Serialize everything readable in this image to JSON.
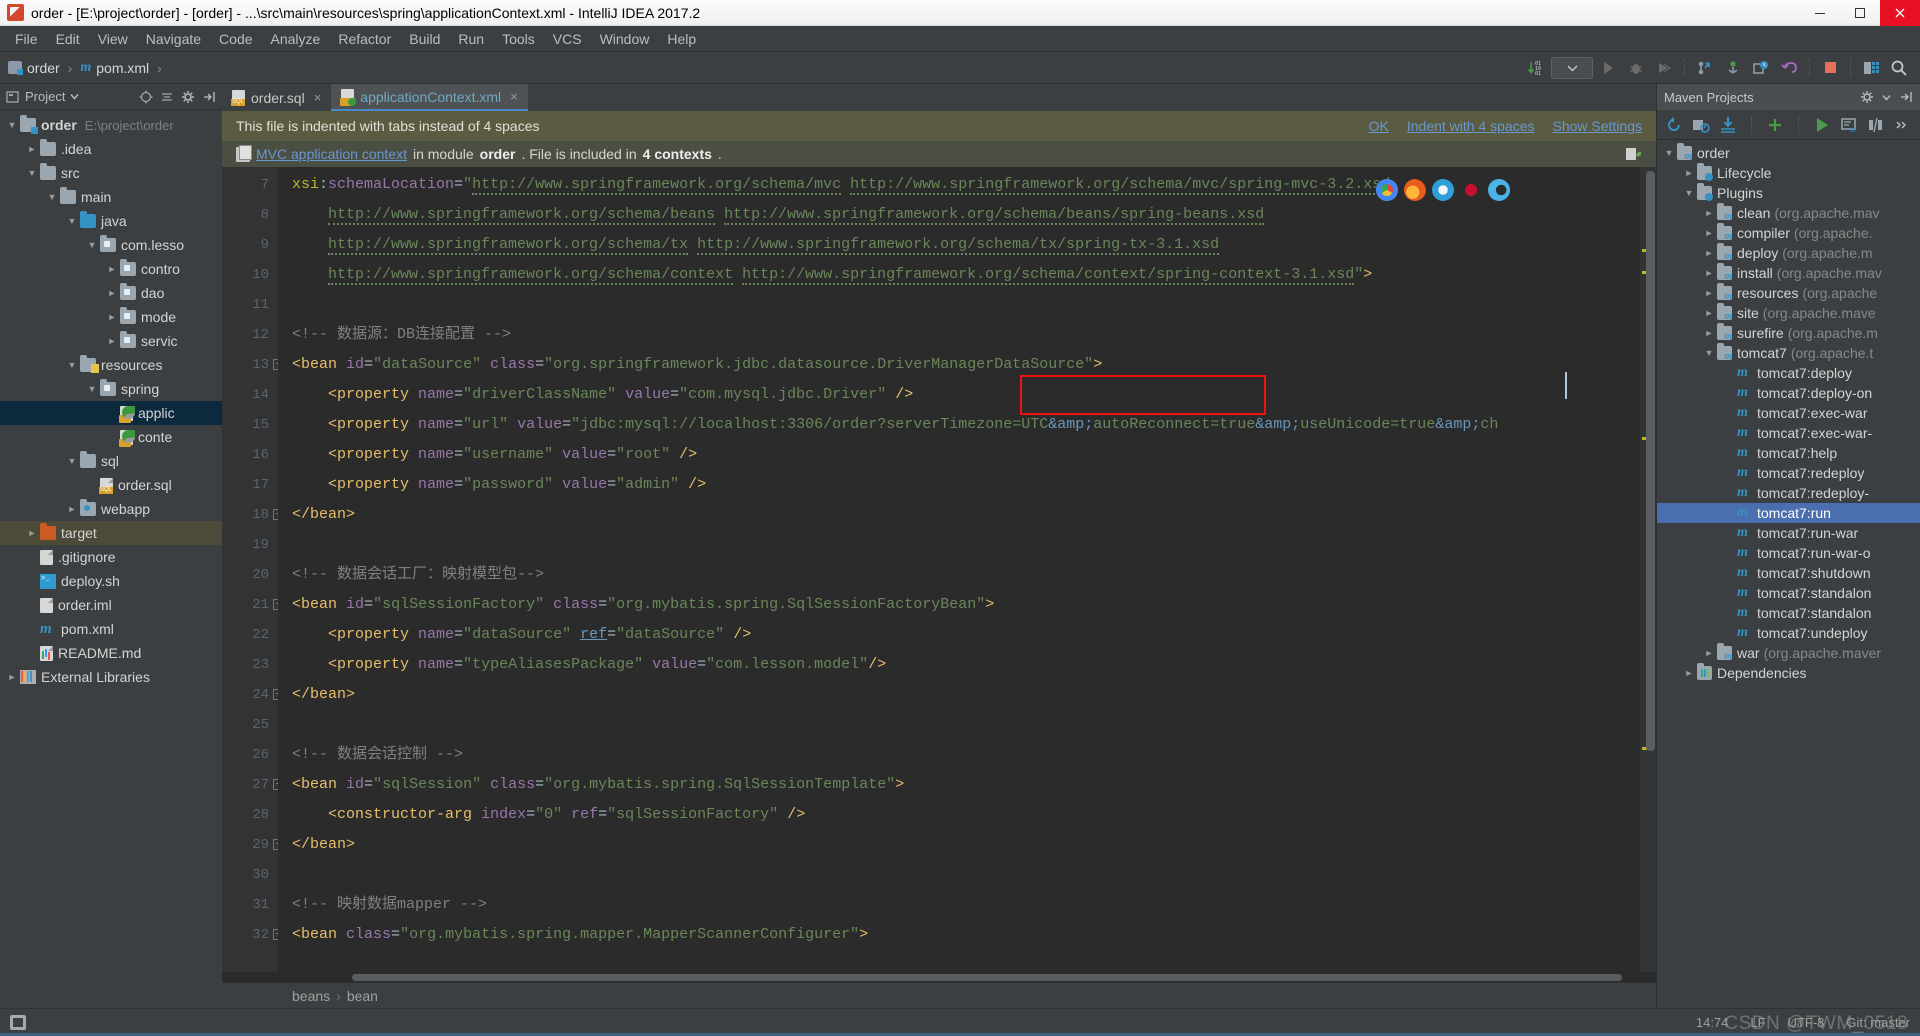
{
  "window": {
    "title": "order - [E:\\project\\order] - [order] - ...\\src\\main\\resources\\spring\\applicationContext.xml - IntelliJ IDEA 2017.2",
    "app_icon": "intellij-idea-icon",
    "minimize": "minimize-icon",
    "maximize": "maximize-icon",
    "close": "close-icon"
  },
  "menu": {
    "items": [
      {
        "label": "File"
      },
      {
        "label": "Edit"
      },
      {
        "label": "View"
      },
      {
        "label": "Navigate"
      },
      {
        "label": "Code"
      },
      {
        "label": "Analyze"
      },
      {
        "label": "Refactor"
      },
      {
        "label": "Build"
      },
      {
        "label": "Run"
      },
      {
        "label": "Tools"
      },
      {
        "label": "VCS"
      },
      {
        "label": "Window"
      },
      {
        "label": "Help"
      }
    ]
  },
  "toolbar": {
    "breadcrumb": [
      {
        "label": "order",
        "icon": "module-icon"
      },
      {
        "label": "pom.xml",
        "icon": "maven-m-icon"
      }
    ],
    "run_config": "",
    "icons": [
      "line-numbers-icon",
      "run-config-dropdown",
      "run-icon",
      "debug-icon",
      "coverage-icon",
      "update-project-icon",
      "commit-icon",
      "history-icon",
      "rollback-icon",
      "stop-icon",
      "database-icon",
      "search-everywhere-icon"
    ]
  },
  "project_panel": {
    "title": "Project",
    "header_icons": [
      "project-view-icon",
      "chevron-down-icon",
      "locate-icon",
      "collapse-all-icon",
      "gear-icon",
      "hide-icon"
    ],
    "tree": [
      {
        "label": "order",
        "path": "E:\\project\\order",
        "depth": 0,
        "arrow": "down",
        "icon": "module-folder",
        "bold": true
      },
      {
        "label": ".idea",
        "depth": 1,
        "arrow": "right",
        "icon": "folder"
      },
      {
        "label": "src",
        "depth": 1,
        "arrow": "down",
        "icon": "folder"
      },
      {
        "label": "main",
        "depth": 2,
        "arrow": "down",
        "icon": "folder"
      },
      {
        "label": "java",
        "depth": 3,
        "arrow": "down",
        "icon": "source-folder"
      },
      {
        "label": "com.lesso",
        "depth": 4,
        "arrow": "down",
        "icon": "package-folder"
      },
      {
        "label": "contro",
        "depth": 5,
        "arrow": "right",
        "icon": "package-folder"
      },
      {
        "label": "dao",
        "depth": 5,
        "arrow": "right",
        "icon": "package-folder"
      },
      {
        "label": "mode",
        "depth": 5,
        "arrow": "right",
        "icon": "package-folder"
      },
      {
        "label": "servic",
        "depth": 5,
        "arrow": "right",
        "icon": "package-folder"
      },
      {
        "label": "resources",
        "depth": 3,
        "arrow": "down",
        "icon": "resources-folder"
      },
      {
        "label": "spring",
        "depth": 4,
        "arrow": "down",
        "icon": "package-folder"
      },
      {
        "label": "applic",
        "depth": 5,
        "arrow": "none",
        "icon": "spring-xml-file",
        "selected": true
      },
      {
        "label": "conte",
        "depth": 5,
        "arrow": "none",
        "icon": "spring-xml-file"
      },
      {
        "label": "sql",
        "depth": 3,
        "arrow": "down",
        "icon": "folder"
      },
      {
        "label": "order.sql",
        "depth": 4,
        "arrow": "none",
        "icon": "sql-file"
      },
      {
        "label": "webapp",
        "depth": 3,
        "arrow": "right",
        "icon": "web-folder"
      },
      {
        "label": "target",
        "depth": 1,
        "arrow": "right",
        "icon": "excluded-folder",
        "highlighted": true
      },
      {
        "label": ".gitignore",
        "depth": 1,
        "arrow": "none",
        "icon": "gitignore-file"
      },
      {
        "label": "deploy.sh",
        "depth": 1,
        "arrow": "none",
        "icon": "shell-file"
      },
      {
        "label": "order.iml",
        "depth": 1,
        "arrow": "none",
        "icon": "iml-file"
      },
      {
        "label": "pom.xml",
        "depth": 1,
        "arrow": "none",
        "icon": "maven-m-icon"
      },
      {
        "label": "README.md",
        "depth": 1,
        "arrow": "none",
        "icon": "markdown-file"
      },
      {
        "label": "External Libraries",
        "depth": 0,
        "arrow": "right",
        "icon": "libraries-icon"
      }
    ]
  },
  "editor": {
    "tabs": [
      {
        "label": "order.sql",
        "icon": "sql-file-icon",
        "active": false
      },
      {
        "label": "applicationContext.xml",
        "icon": "spring-xml-file-icon",
        "active": true
      }
    ],
    "banner_indent": {
      "message": "This file is indented with tabs instead of 4 spaces",
      "links": [
        "OK",
        "Indent with 4 spaces",
        "Show Settings"
      ]
    },
    "banner_context": {
      "link": "MVC application context",
      "text_mid": "in module",
      "module": "order",
      "text_after": ". File is included in",
      "contexts": "4 contexts",
      "text_end": ".",
      "right_icon": "spring-config-icon"
    },
    "browsers": [
      "chrome-icon",
      "firefox-icon",
      "safari-icon",
      "opera-icon",
      "edge-icon"
    ],
    "first_line_number": 7,
    "lines": [
      {
        "n": 7,
        "fold": false,
        "html": "<span class=\"ns\">xsi</span><span class=\"plain\">:</span><span class=\"attr\">schemaLocation</span><span class=\"plain\">=</span><span class=\"str\">\"</span><span class=\"str wavy\">http://www.springframework.org/schema/mvc</span><span class=\"str\"> </span><span class=\"str wavy\">http://www.springframework.org/schema/mvc/spring-mvc-3.2.xsd</span>"
      },
      {
        "n": 8,
        "fold": false,
        "html": "    <span class=\"str wavy\">http://www.springframework.org/schema/beans</span><span class=\"str\"> </span><span class=\"str wavy\">http://www.springframework.org/schema/beans/spring-beans.xsd</span>"
      },
      {
        "n": 9,
        "fold": false,
        "html": "    <span class=\"str wavy\">http://www.springframework.org/schema/tx</span><span class=\"str\"> </span><span class=\"str wavy\">http://www.springframework.org/schema/tx/spring-tx-3.1.xsd</span>"
      },
      {
        "n": 10,
        "fold": false,
        "html": "    <span class=\"str wavy\">http://www.springframework.org/schema/context</span><span class=\"str\"> </span><span class=\"str wavy\">http://www.springframework.org/schema/context/spring-context-3.1.xsd</span><span class=\"str\">\"</span><span class=\"tag\">&gt;</span>"
      },
      {
        "n": 11,
        "fold": false,
        "html": ""
      },
      {
        "n": 12,
        "fold": false,
        "html": "<span class=\"cmt\">&lt;!-- 数据源：DB连接配置 --&gt;</span>"
      },
      {
        "n": 13,
        "fold": true,
        "html": "<span class=\"tag\">&lt;bean</span> <span class=\"attr\">id</span><span class=\"plain\">=</span><span class=\"str\">\"dataSource\"</span> <span class=\"attr\">class</span><span class=\"plain\">=</span><span class=\"str\">\"org.springframework.jdbc.datasource.DriverManagerDataSource\"</span><span class=\"tag\">&gt;</span>"
      },
      {
        "n": 14,
        "fold": false,
        "html": "    <span class=\"tag\">&lt;property</span> <span class=\"attr\">name</span><span class=\"plain\">=</span><span class=\"str\">\"driverClassName\"</span> <span class=\"attr\">value</span><span class=\"plain\">=</span><span class=\"str\">\"com.mysql.jdbc.Driver\"</span> <span class=\"tag\">/&gt;</span>"
      },
      {
        "n": 15,
        "fold": false,
        "html": "    <span class=\"tag\">&lt;property</span> <span class=\"attr\">name</span><span class=\"plain\">=</span><span class=\"str\">\"url\"</span> <span class=\"attr\">value</span><span class=\"plain\">=</span><span class=\"str\">\"jdbc:mysql://localhost:3306/order?serverTimezone=UTC</span><span class=\"ent\">&amp;amp;</span><span class=\"str\">autoReconnect=true</span><span class=\"ent\">&amp;amp;</span><span class=\"str\">useUnicode=true</span><span class=\"ent\">&amp;amp;</span><span class=\"str\">ch</span>"
      },
      {
        "n": 16,
        "fold": false,
        "html": "    <span class=\"tag\">&lt;property</span> <span class=\"attr\">name</span><span class=\"plain\">=</span><span class=\"str\">\"username\"</span> <span class=\"attr\">value</span><span class=\"plain\">=</span><span class=\"str\">\"root\"</span> <span class=\"tag\">/&gt;</span>"
      },
      {
        "n": 17,
        "fold": false,
        "html": "    <span class=\"tag\">&lt;property</span> <span class=\"attr\">name</span><span class=\"plain\">=</span><span class=\"str\">\"password\"</span> <span class=\"attr\">value</span><span class=\"plain\">=</span><span class=\"str\">\"admin\"</span> <span class=\"tag\">/&gt;</span>"
      },
      {
        "n": 18,
        "fold": true,
        "html": "<span class=\"tag\">&lt;/bean&gt;</span>"
      },
      {
        "n": 19,
        "fold": false,
        "html": ""
      },
      {
        "n": 20,
        "fold": false,
        "html": "<span class=\"cmt\">&lt;!-- 数据会话工厂：映射模型包--&gt;</span>"
      },
      {
        "n": 21,
        "fold": true,
        "html": "<span class=\"tag\">&lt;bean</span> <span class=\"attr\">id</span><span class=\"plain\">=</span><span class=\"str\">\"sqlSessionFactory\"</span> <span class=\"attr\">class</span><span class=\"plain\">=</span><span class=\"str\">\"org.mybatis.spring.SqlSessionFactoryBean\"</span><span class=\"tag\">&gt;</span>"
      },
      {
        "n": 22,
        "fold": false,
        "html": "    <span class=\"tag\">&lt;property</span> <span class=\"attr\">name</span><span class=\"plain\">=</span><span class=\"str\">\"dataSource\"</span> <span class=\"reflink\">ref</span><span class=\"plain\">=</span><span class=\"str\">\"dataSource\"</span> <span class=\"tag\">/&gt;</span>"
      },
      {
        "n": 23,
        "fold": false,
        "html": "    <span class=\"tag\">&lt;property</span> <span class=\"attr\">name</span><span class=\"plain\">=</span><span class=\"str\">\"typeAliasesPackage\"</span> <span class=\"attr\">value</span><span class=\"plain\">=</span><span class=\"str\">\"com.lesson.model\"</span><span class=\"tag\">/&gt;</span>"
      },
      {
        "n": 24,
        "fold": true,
        "html": "<span class=\"tag\">&lt;/bean&gt;</span>"
      },
      {
        "n": 25,
        "fold": false,
        "html": ""
      },
      {
        "n": 26,
        "fold": false,
        "html": "<span class=\"cmt\">&lt;!-- 数据会话控制 --&gt;</span>"
      },
      {
        "n": 27,
        "fold": true,
        "html": "<span class=\"tag\">&lt;bean</span> <span class=\"attr\">id</span><span class=\"plain\">=</span><span class=\"str\">\"sqlSession\"</span> <span class=\"attr\">class</span><span class=\"plain\">=</span><span class=\"str\">\"org.mybatis.spring.SqlSessionTemplate\"</span><span class=\"tag\">&gt;</span>"
      },
      {
        "n": 28,
        "fold": false,
        "html": "    <span class=\"tag\">&lt;constructor-arg</span> <span class=\"attr\">index</span><span class=\"plain\">=</span><span class=\"str\">\"0\"</span> <span class=\"attr\">ref</span><span class=\"plain\">=</span><span class=\"str\">\"sqlSessionFactory\"</span> <span class=\"tag\">/&gt;</span>"
      },
      {
        "n": 29,
        "fold": true,
        "html": "<span class=\"tag\">&lt;/bean&gt;</span>"
      },
      {
        "n": 30,
        "fold": false,
        "html": ""
      },
      {
        "n": 31,
        "fold": false,
        "html": "<span class=\"cmt\">&lt;!-- 映射数据mapper --&gt;</span>"
      },
      {
        "n": 32,
        "fold": true,
        "html": "<span class=\"tag\">&lt;bean</span> <span class=\"attr\">class</span><span class=\"plain\">=</span><span class=\"str\">\"org.mybatis.spring.mapper.MapperScannerConfigurer\"</span><span class=\"tag\">&gt;</span>"
      }
    ],
    "breadcrumbs": [
      "beans",
      "bean"
    ]
  },
  "maven_panel": {
    "title": "Maven Projects",
    "header_icons": [
      "gear-icon",
      "hide-icon"
    ],
    "toolbar_icons": [
      "reimport-icon",
      "generate-sources-icon",
      "download-sources-icon",
      "add-icon",
      "run-icon",
      "execute-goal-icon",
      "toggle-offline-icon",
      "more-icon"
    ],
    "tree": [
      {
        "label": "order",
        "depth": 0,
        "arrow": "down",
        "icon": "maven-project-icon"
      },
      {
        "label": "Lifecycle",
        "depth": 1,
        "arrow": "right",
        "icon": "maven-phase-icon"
      },
      {
        "label": "Plugins",
        "depth": 1,
        "arrow": "down",
        "icon": "maven-phase-icon"
      },
      {
        "label": "clean",
        "grey": "(org.apache.mav",
        "depth": 2,
        "arrow": "right",
        "icon": "maven-plugin-icon"
      },
      {
        "label": "compiler",
        "grey": "(org.apache.",
        "depth": 2,
        "arrow": "right",
        "icon": "maven-plugin-icon"
      },
      {
        "label": "deploy",
        "grey": "(org.apache.m",
        "depth": 2,
        "arrow": "right",
        "icon": "maven-plugin-icon"
      },
      {
        "label": "install",
        "grey": "(org.apache.mav",
        "depth": 2,
        "arrow": "right",
        "icon": "maven-plugin-icon"
      },
      {
        "label": "resources",
        "grey": "(org.apache",
        "depth": 2,
        "arrow": "right",
        "icon": "maven-plugin-icon"
      },
      {
        "label": "site",
        "grey": "(org.apache.mave",
        "depth": 2,
        "arrow": "right",
        "icon": "maven-plugin-icon"
      },
      {
        "label": "surefire",
        "grey": "(org.apache.m",
        "depth": 2,
        "arrow": "right",
        "icon": "maven-plugin-icon"
      },
      {
        "label": "tomcat7",
        "grey": "(org.apache.t",
        "depth": 2,
        "arrow": "down",
        "icon": "maven-plugin-icon"
      },
      {
        "label": "tomcat7:deploy",
        "depth": 3,
        "arrow": "none",
        "icon": "maven-goal-icon"
      },
      {
        "label": "tomcat7:deploy-on",
        "depth": 3,
        "arrow": "none",
        "icon": "maven-goal-icon"
      },
      {
        "label": "tomcat7:exec-war",
        "depth": 3,
        "arrow": "none",
        "icon": "maven-goal-icon"
      },
      {
        "label": "tomcat7:exec-war-",
        "depth": 3,
        "arrow": "none",
        "icon": "maven-goal-icon"
      },
      {
        "label": "tomcat7:help",
        "depth": 3,
        "arrow": "none",
        "icon": "maven-goal-icon"
      },
      {
        "label": "tomcat7:redeploy",
        "depth": 3,
        "arrow": "none",
        "icon": "maven-goal-icon"
      },
      {
        "label": "tomcat7:redeploy-",
        "depth": 3,
        "arrow": "none",
        "icon": "maven-goal-icon"
      },
      {
        "label": "tomcat7:run",
        "depth": 3,
        "arrow": "none",
        "icon": "maven-goal-icon",
        "selected": true
      },
      {
        "label": "tomcat7:run-war",
        "depth": 3,
        "arrow": "none",
        "icon": "maven-goal-icon"
      },
      {
        "label": "tomcat7:run-war-o",
        "depth": 3,
        "arrow": "none",
        "icon": "maven-goal-icon"
      },
      {
        "label": "tomcat7:shutdown",
        "depth": 3,
        "arrow": "none",
        "icon": "maven-goal-icon"
      },
      {
        "label": "tomcat7:standalon",
        "depth": 3,
        "arrow": "none",
        "icon": "maven-goal-icon"
      },
      {
        "label": "tomcat7:standalon",
        "depth": 3,
        "arrow": "none",
        "icon": "maven-goal-icon"
      },
      {
        "label": "tomcat7:undeploy",
        "depth": 3,
        "arrow": "none",
        "icon": "maven-goal-icon"
      },
      {
        "label": "war",
        "grey": "(org.apache.maver",
        "depth": 2,
        "arrow": "right",
        "icon": "maven-plugin-icon"
      },
      {
        "label": "Dependencies",
        "depth": 1,
        "arrow": "right",
        "icon": "maven-dependencies-icon"
      }
    ]
  },
  "status_bar": {
    "left_icon": "toggle-toolwindows-icon",
    "caret_position": "14:74",
    "line_separator": "LF",
    "encoding": "UTF-8",
    "vcs_branch": "Git: master",
    "watermark": "CSDN @TWM_0518"
  },
  "colors": {
    "accent": "#4b6eaf",
    "editor_bg": "#2b2b2b",
    "panel_bg": "#3c3f41",
    "error_box": "#ee1111",
    "link": "#6897d1",
    "string": "#6a8759",
    "tag": "#e8bf6a",
    "attribute": "#9876aa",
    "comment": "#808080",
    "entity": "#6897bb",
    "selection": "#4b6eaf"
  }
}
